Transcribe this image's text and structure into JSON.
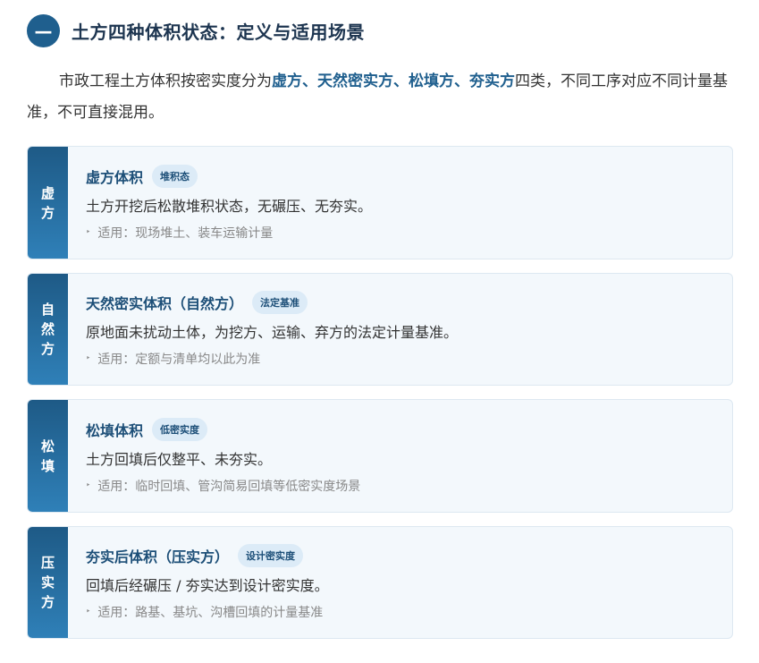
{
  "section": {
    "number_icon": "minus-icon",
    "title": "土方四种体积状态：定义与适用场景"
  },
  "intro": {
    "prefix": "市政工程土方体积按密实度分为",
    "t1": "虚方",
    "sep1": "、",
    "t2": "天然密实方",
    "sep2": "、",
    "t3": "松填方",
    "sep3": "、",
    "t4": "夯实方",
    "suffix": "四类，不同工序对应不同计量基准，不可直接混用。"
  },
  "cards": [
    {
      "side": [
        "虚",
        "方"
      ],
      "title": "虚方体积",
      "badge": "堆积态",
      "desc": "土方开挖后松散堆积状态，无碾压、无夯实。",
      "usage": "适用：现场堆土、装车运输计量"
    },
    {
      "side": [
        "自",
        "然",
        "方"
      ],
      "title": "天然密实体积（自然方）",
      "badge": "法定基准",
      "desc": "原地面未扰动土体，为挖方、运输、弃方的法定计量基准。",
      "usage": "适用：定额与清单均以此为准"
    },
    {
      "side": [
        "松",
        "填"
      ],
      "title": "松填体积",
      "badge": "低密实度",
      "desc": "土方回填后仅整平、未夯实。",
      "usage": "适用：临时回填、管沟简易回填等低密实度场景"
    },
    {
      "side": [
        "压",
        "实",
        "方"
      ],
      "title": "夯实后体积（压实方）",
      "badge": "设计密实度",
      "desc": "回填后经碾压 / 夯实达到设计密实度。",
      "usage": "适用：路基、基坑、沟槽回填的计量基准"
    }
  ],
  "usage_marker": "‣"
}
